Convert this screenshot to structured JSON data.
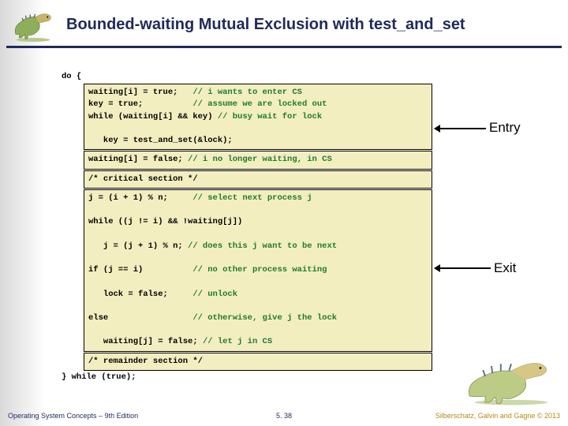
{
  "slide": {
    "title": "Bounded-waiting Mutual Exclusion with test_and_set"
  },
  "labels": {
    "entry": "Entry",
    "exit": "Exit"
  },
  "code": {
    "line_do": "do {",
    "entry_box": "waiting[i] = true;   // i wants to enter CS\nkey = true;          // assume we are locked out\nwhile (waiting[i] && key) // busy wait for lock\n\n   key = test_and_set(&lock);",
    "mid_box": "waiting[i] = false; // i no longer waiting, in CS",
    "cs_box": "/* critical section */",
    "exit_box": "j = (i + 1) % n;     // select next process j\n\nwhile ((j != i) && !waiting[j])\n\n   j = (j + 1) % n; // does this j want to be next\n\nif (j == i)          // no other process waiting\n\n   lock = false;     // unlock\n\nelse                 // otherwise, give j the lock\n\n   waiting[j] = false; // let j in CS",
    "rem_box": "/* remainder section */",
    "line_while": "} while (true);"
  },
  "footer": {
    "left": "Operating System Concepts – 9th Edition",
    "center": "5. 38",
    "right": "Silberschatz, Galvin and Gagne © 2013"
  }
}
